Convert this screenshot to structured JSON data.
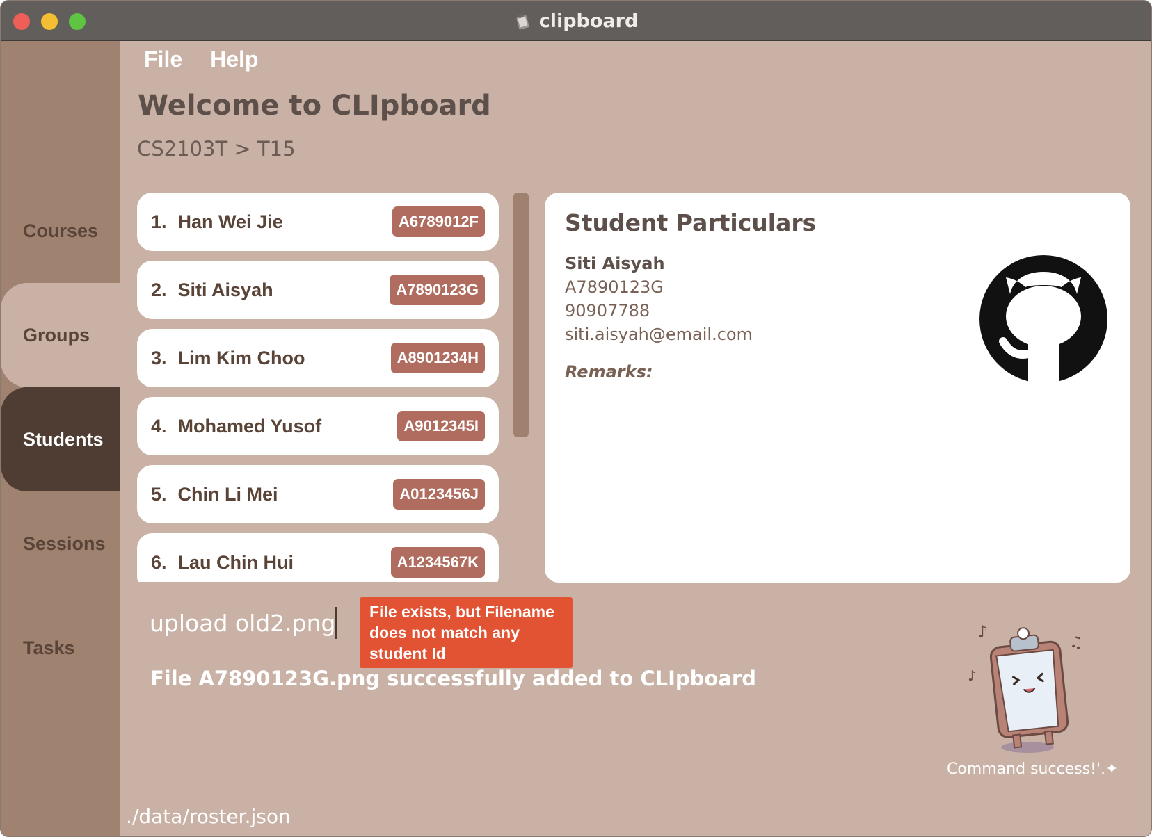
{
  "window": {
    "title": "clipboard",
    "icon": "clipboard-app-icon"
  },
  "menu": {
    "file": "File",
    "help": "Help"
  },
  "sidebar": {
    "items": [
      {
        "label": "Courses"
      },
      {
        "label": "Groups"
      },
      {
        "label": "Students",
        "selected": true
      },
      {
        "label": "Sessions"
      },
      {
        "label": "Tasks"
      }
    ]
  },
  "header": {
    "title": "Welcome to CLIpboard",
    "breadcrumb": "CS2103T > T15"
  },
  "students": [
    {
      "index": "1.",
      "name": "Han Wei Jie",
      "id": "A6789012F"
    },
    {
      "index": "2.",
      "name": "Siti Aisyah",
      "id": "A7890123G"
    },
    {
      "index": "3.",
      "name": "Lim Kim Choo",
      "id": "A8901234H"
    },
    {
      "index": "4.",
      "name": "Mohamed Yusof",
      "id": "A9012345I"
    },
    {
      "index": "5.",
      "name": "Chin Li Mei",
      "id": "A0123456J"
    },
    {
      "index": "6.",
      "name": "Lau Chin Hui",
      "id": "A1234567K"
    }
  ],
  "particulars": {
    "title": "Student Particulars",
    "name": "Siti Aisyah",
    "student_id": "A7890123G",
    "phone": "90907788",
    "email": "siti.aisyah@email.com",
    "remarks_label": "Remarks:",
    "avatar_icon": "github-octocat-icon"
  },
  "command": {
    "input_value": "upload old2.png",
    "tooltip": "File exists, but Filename does not match any student Id",
    "result": "File A7890123G.png successfully added to CLIpboard"
  },
  "mascot": {
    "caption": "Command success!'.✦",
    "icon": "clipboard-mascot-icon"
  },
  "status": {
    "path": "./data/roster.json"
  },
  "colors": {
    "background": "#c9b2a5",
    "sidebar": "#9f8270",
    "selected_nav": "#4f3c32",
    "id_badge": "#b06d5f",
    "tooltip": "#e15333",
    "titlebar": "#625e5c"
  }
}
